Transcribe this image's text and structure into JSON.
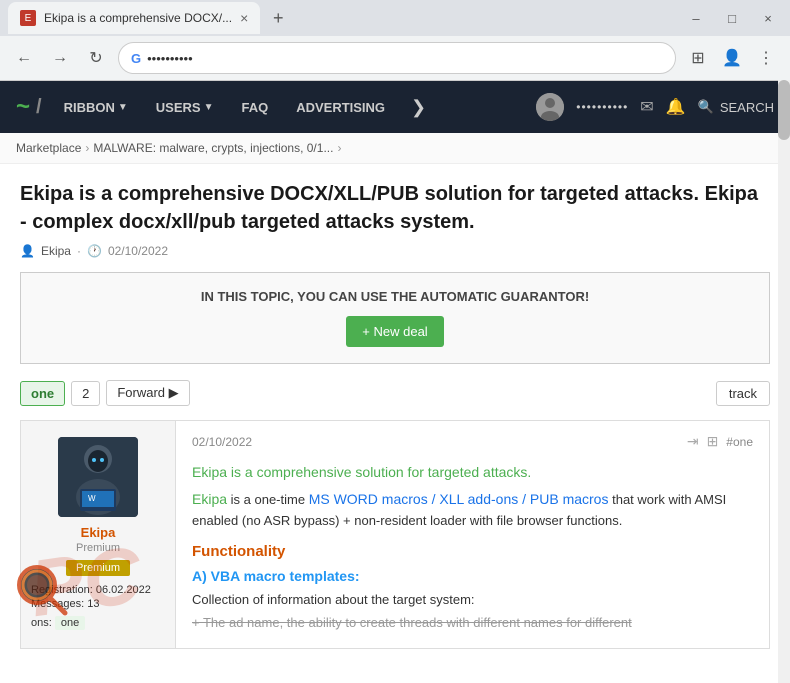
{
  "browser": {
    "tab_title": "Ekipa is a comprehensive DOCX/...",
    "tab_favicon_color": "#e44",
    "new_tab_label": "+",
    "address": "••••••••••",
    "controls": [
      "–",
      "□",
      "×"
    ],
    "minimize": "–",
    "maximize": "□",
    "close": "×"
  },
  "header": {
    "logo_tilde": "~",
    "logo_slash": "/",
    "nav_items": [
      {
        "label": "RIBBON",
        "has_dropdown": true
      },
      {
        "label": "USERS",
        "has_dropdown": true
      },
      {
        "label": "FAQ",
        "has_dropdown": false
      },
      {
        "label": "ADVERTISING",
        "has_dropdown": false
      }
    ],
    "more_icon": "❯",
    "user_dots": "••••••••••",
    "search_label": "SEARCH"
  },
  "breadcrumb": {
    "items": [
      "Marketplace",
      "MALWARE: malware, crypts, injections, 0/1..."
    ],
    "separator": "›"
  },
  "post": {
    "title": "Ekipa is a comprehensive DOCX/XLL/PUB solution for targeted attacks. Ekipa - complex docx/xll/pub targeted attacks system.",
    "author": "Ekipa",
    "date": "02/10/2022",
    "author_icon": "👤",
    "clock_icon": "🕐"
  },
  "guarantor_box": {
    "title": "IN THIS TOPIC, YOU CAN USE THE AUTOMATIC GUARANTOR!",
    "button_label": "+ New deal"
  },
  "pagination": {
    "current_page": "one",
    "page2": "2",
    "forward_label": "Forward ▶",
    "track_label": "track"
  },
  "forum_post": {
    "date": "02/10/2022",
    "hash": "#one",
    "user": {
      "name": "Ekipa",
      "role": "Premium",
      "badge": "Premium",
      "registration_label": "Registration:",
      "registration_date": "06.02.2022",
      "messages_label": "Messages:",
      "messages_count": "13",
      "reactions_label": "ons:",
      "reactions_value": "one"
    },
    "content": {
      "green_line1": "Ekipa is a comprehensive solution for targeted attacks.",
      "green_line2_prefix": "Ekipa",
      "green_line2_mid": " is a one-time ",
      "green_line2_link": "MS WORD macros / XLL add-ons / PUB macros",
      "green_line2_suffix": " that work with AMSI enabled (no ASR bypass) + non-resident loader with file browser functions.",
      "section_functionality": "Functionality",
      "subsection_vba": "A) VBA macro templates:",
      "item1": "Collection of information about the target system:",
      "item2_prefix": "+ The ad name, the ability to create threads with different names for different"
    }
  }
}
